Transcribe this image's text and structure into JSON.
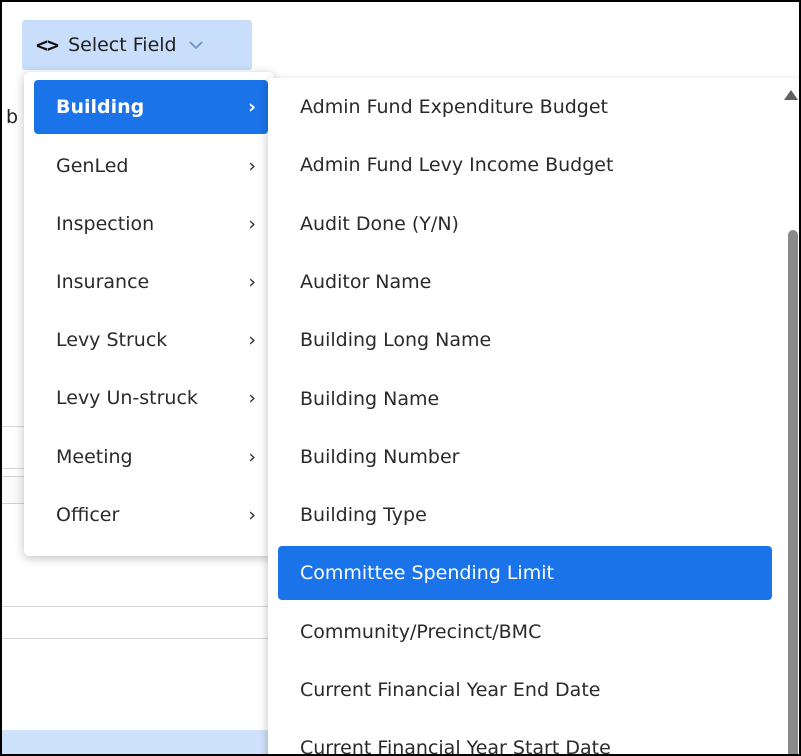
{
  "select_field": {
    "icon": "code-icon",
    "label": "Select Field",
    "chevron": "chevron-down-icon"
  },
  "categories": [
    {
      "label": "Building",
      "active": true
    },
    {
      "label": "GenLed",
      "active": false
    },
    {
      "label": "Inspection",
      "active": false
    },
    {
      "label": "Insurance",
      "active": false
    },
    {
      "label": "Levy Struck",
      "active": false
    },
    {
      "label": "Levy Un-struck",
      "active": false
    },
    {
      "label": "Meeting",
      "active": false
    },
    {
      "label": "Officer",
      "active": false
    }
  ],
  "category_arrow": "›",
  "fields": [
    {
      "label": "Admin Fund Expenditure Budget",
      "active": false
    },
    {
      "label": "Admin Fund Levy Income Budget",
      "active": false
    },
    {
      "label": "Audit Done (Y/N)",
      "active": false
    },
    {
      "label": "Auditor Name",
      "active": false
    },
    {
      "label": "Building Long Name",
      "active": false
    },
    {
      "label": "Building Name",
      "active": false
    },
    {
      "label": "Building Number",
      "active": false
    },
    {
      "label": "Building Type",
      "active": false
    },
    {
      "label": "Committee Spending Limit",
      "active": true
    },
    {
      "label": "Community/Precinct/BMC",
      "active": false
    },
    {
      "label": "Current Financial Year End Date",
      "active": false
    },
    {
      "label": "Current Financial Year Start Date",
      "active": false
    }
  ],
  "background": {
    "partial_text": "b"
  },
  "colors": {
    "accent": "#1a73e8",
    "button_bg": "#c8defa"
  }
}
